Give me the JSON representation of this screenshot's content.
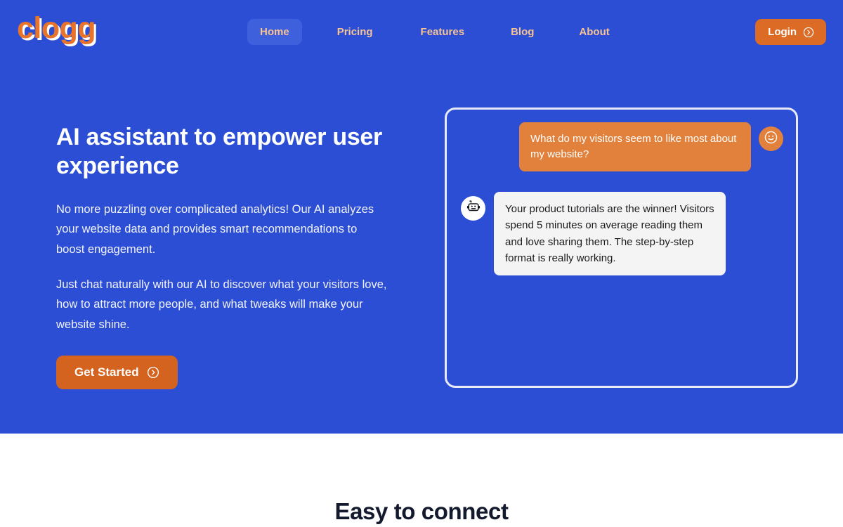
{
  "brand": {
    "logo_text": "clogg",
    "colors": {
      "hero_blue": "#2B4ED4",
      "accent_orange": "#DB6B25",
      "bubble_orange": "#E2813C",
      "nav_text": "#F7C393",
      "nav_active_pill": "#3E60DD",
      "bot_bubble": "#F4F4F4",
      "dark_navy": "#141A2E"
    }
  },
  "navbar": {
    "items": [
      {
        "label": "Home",
        "active": true
      },
      {
        "label": "Pricing",
        "active": false
      },
      {
        "label": "Features",
        "active": false
      },
      {
        "label": "Blog",
        "active": false
      },
      {
        "label": "About",
        "active": false
      }
    ],
    "login": {
      "label": "Login",
      "icon": "circle-chevron-right-icon"
    }
  },
  "hero": {
    "headline": "AI assistant to empower user experience",
    "paragraph_1": "No more puzzling over complicated analytics! Our AI analyzes your website data and provides smart recommendations to boost engagement.",
    "paragraph_2": "Just chat naturally with our AI to discover what your visitors love, how to attract more people, and what tweaks will make your website shine.",
    "cta": {
      "label": "Get Started",
      "icon": "circle-chevron-right-icon"
    }
  },
  "chat": {
    "messages": [
      {
        "role": "user",
        "text": "What do my visitors seem to like most about my website?",
        "avatar_icon": "smiley-face-icon"
      },
      {
        "role": "bot",
        "text": "Your product tutorials are the winner! Visitors spend 5 minutes on average reading them and love sharing them. The step-by-step format is really working.",
        "avatar_icon": "robot-icon"
      }
    ]
  },
  "connect_section": {
    "title": "Easy to connect"
  }
}
